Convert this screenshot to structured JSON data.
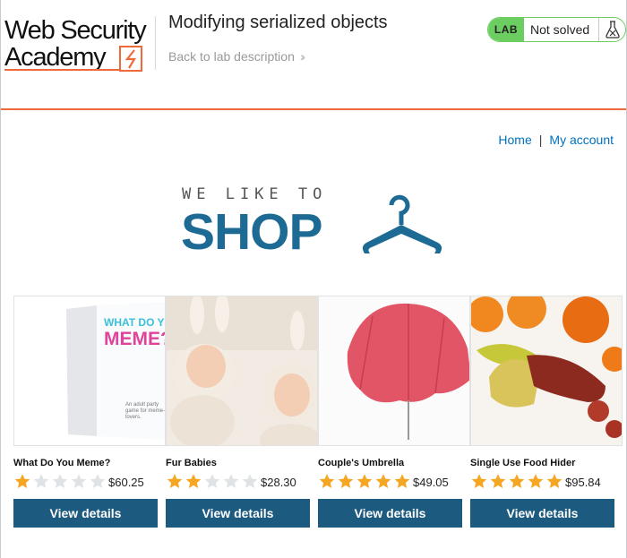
{
  "header": {
    "logo_line1": "Web Security",
    "logo_line2": "Academy",
    "lab_title": "Modifying serialized objects",
    "back_link": "Back to lab description",
    "status": {
      "badge": "LAB",
      "text": "Not solved"
    },
    "colors": {
      "accent": "#ee6a3b",
      "lab_green": "#6ccd61"
    }
  },
  "nav": {
    "home": "Home",
    "separator": "|",
    "account": "My account"
  },
  "banner": {
    "tagline": "WE LIKE TO",
    "word": "SHOP"
  },
  "view_details_label": "View details",
  "products": [
    {
      "name": "What Do You Meme?",
      "rating": 1,
      "price": "$60.25",
      "box_line1": "WHAT DO YOU",
      "box_line2": "MEME?",
      "box_sub": "An adult party game for meme-lovers."
    },
    {
      "name": "Fur Babies",
      "rating": 2,
      "price": "$28.30"
    },
    {
      "name": "Couple's Umbrella",
      "rating": 5,
      "price": "$49.05"
    },
    {
      "name": "Single Use Food Hider",
      "rating": 5,
      "price": "$95.84"
    }
  ],
  "colors": {
    "link": "#0071bc",
    "button": "#1d5a7f",
    "banner": "#1d6a95",
    "star_on": "#f5a623",
    "star_off": "#dfe3e6"
  }
}
